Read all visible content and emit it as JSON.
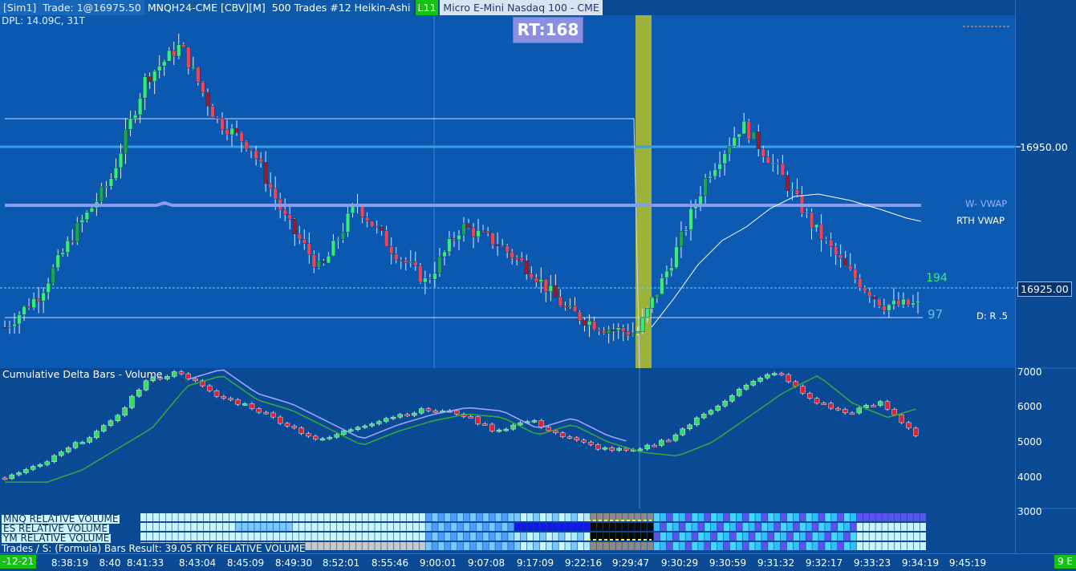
{
  "header": {
    "account": "[Sim1]",
    "trade": "Trade: 1@16975.50",
    "symbol": "MNQH24-CME [CBV][M]",
    "bar_type": "500 Trades #12 Heikin-Ashi",
    "level_badge": "L11",
    "description": "Micro E-Mini Nasdaq 100 - CME"
  },
  "dpl": "DPL: 14.09C, 31T",
  "rt_badge": "RT:168",
  "price_axis": {
    "labels": [
      "16950.00",
      "16925.00"
    ],
    "highlight_color": "#06336e"
  },
  "signals": {
    "w_vwap": "W- VWAP",
    "rth_vwap": "RTH VWAP",
    "count_194": "194",
    "count_97": "97",
    "dr": "D: R .5"
  },
  "volume_panel": {
    "title": "Cumulative Delta Bars - Volume",
    "ticks": [
      "7000",
      "6000",
      "5000",
      "4000",
      "3000"
    ]
  },
  "relative_volume": {
    "rows": [
      "MNQ RELATIVE VOLUME",
      "ES RELATIVE VOLUME",
      "YM RELATIVE VOLUME"
    ]
  },
  "bottom_legend": "Trades / S: (Formula) Bars  Result: 39.05  RTY RELATIVE VOLUME",
  "time_axis": {
    "date": "-12-21",
    "labels": [
      "8:38:19",
      "8:40",
      "8:41:33",
      "8:43:04",
      "8:45:09",
      "8:49:30",
      "8:52:01",
      "8:55:46",
      "9:00:01",
      "9:07:08",
      "9:17:09",
      "9:22:16",
      "9:29:47",
      "9:30:29",
      "9:30:59",
      "9:31:32",
      "9:32:17",
      "9:33:23",
      "9:34:19",
      "9:45:19"
    ],
    "corner": "9 E"
  },
  "colors": {
    "background": "#0a4a94",
    "bull": "#33ee77",
    "bear": "#ee4455",
    "vwap": "#8a9cf0",
    "accent_green": "#16c116"
  },
  "chart_data": {
    "type": "candlestick",
    "title": "MNQH24-CME [CBV][M] 500 Trades #12 Heikin-Ashi",
    "price_labels": [
      16950.0,
      16925.0
    ],
    "volume_axis": [
      3000,
      4000,
      5000,
      6000,
      7000
    ],
    "x": [
      "8:38:19",
      "8:40",
      "8:41:33",
      "8:43:04",
      "8:45:09",
      "8:49:30",
      "8:52:01",
      "8:55:46",
      "9:00:01",
      "9:07:08",
      "9:17:09",
      "9:22:16",
      "9:29:47",
      "9:30:29",
      "9:30:59",
      "9:31:32",
      "9:32:17",
      "9:33:23",
      "9:34:19",
      "9:45:19"
    ],
    "close_path": [
      16918,
      16924,
      16935,
      16944,
      16962,
      16968,
      16955,
      16950,
      16937,
      16928,
      16940,
      16932,
      16926,
      16936,
      16933,
      16928,
      16921,
      16918,
      16917,
      16930,
      16945,
      16954,
      16946,
      16936,
      16928,
      16922,
      16922
    ],
    "cum_delta": [
      3950,
      4300,
      4900,
      5500,
      6700,
      7000,
      6300,
      6000,
      5500,
      5000,
      5400,
      5700,
      5900,
      5800,
      5300,
      5600,
      5100,
      4800,
      4700,
      5100,
      5800,
      6500,
      7000,
      6200,
      5800,
      6100,
      5200
    ],
    "grid": false
  }
}
